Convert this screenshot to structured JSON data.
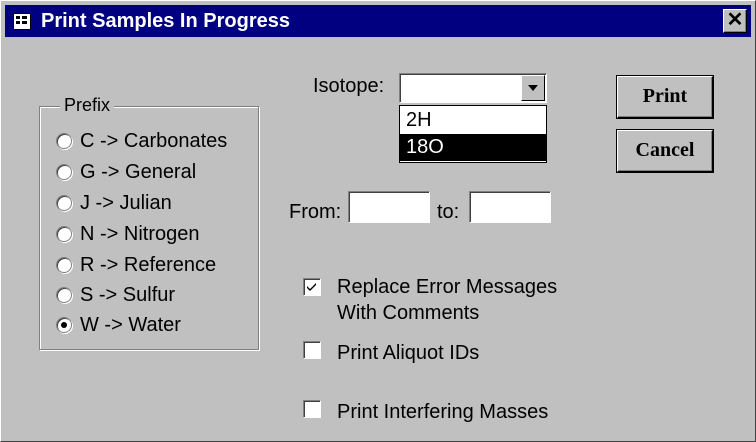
{
  "window": {
    "title": "Print Samples In Progress",
    "title_icon": "form-icon",
    "close_icon": "close-icon",
    "close_glyph": "✕"
  },
  "prefix_group": {
    "label": "Prefix",
    "options": [
      {
        "label": "C -> Carbonates",
        "selected": false
      },
      {
        "label": "G -> General",
        "selected": false
      },
      {
        "label": "J -> Julian",
        "selected": false
      },
      {
        "label": "N -> Nitrogen",
        "selected": false
      },
      {
        "label": "R -> Reference",
        "selected": false
      },
      {
        "label": "S -> Sulfur",
        "selected": false
      },
      {
        "label": "W -> Water",
        "selected": true
      }
    ]
  },
  "isotope": {
    "label": "Isotope:",
    "value": "",
    "options": [
      "2H",
      "18O"
    ],
    "highlighted": "18O"
  },
  "range": {
    "from_label": "From:",
    "from_value": "",
    "to_label": "to:",
    "to_value": ""
  },
  "buttons": {
    "print": "Print",
    "cancel": "Cancel"
  },
  "options": {
    "replace_errors": {
      "label_line1": "Replace Error Messages",
      "label_line2": "With Comments",
      "checked": true
    },
    "aliquot_ids": {
      "label": "Print Aliquot IDs",
      "checked": false
    },
    "interfering_masses": {
      "label": "Print Interfering Masses",
      "checked": false
    }
  }
}
